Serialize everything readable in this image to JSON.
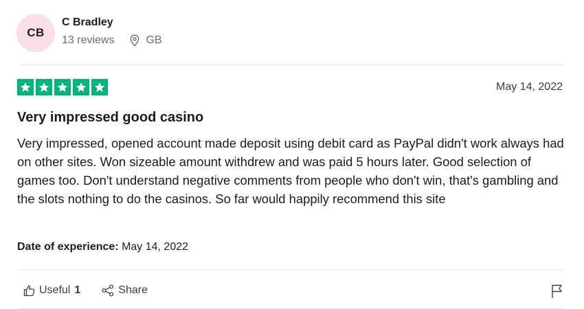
{
  "consumer": {
    "initials": "CB",
    "name": "C Bradley",
    "reviews_count": "13 reviews",
    "country": "GB",
    "avatar_color": "#fcdfe6"
  },
  "review": {
    "rating": 5,
    "max_rating": 5,
    "star_color": "#00b67a",
    "date": "May 14, 2022",
    "title": "Very impressed good casino",
    "text": "Very impressed, opened account made deposit using debit card as PayPal didn't work always had on other sites. Won sizeable amount withdrew and was paid 5 hours later. Good selection of games too. Don't understand negative comments from people who don't win, that's gambling and the slots nothing to do the casinos. So far would happily recommend this site",
    "date_of_experience_label": "Date of experience:",
    "date_of_experience": "May 14, 2022"
  },
  "actions": {
    "useful_label": "Useful",
    "useful_count": "1",
    "share_label": "Share",
    "icons": [
      "thumbs-up-icon",
      "share-icon",
      "flag-icon",
      "location-pin-icon",
      "star-icon"
    ]
  }
}
